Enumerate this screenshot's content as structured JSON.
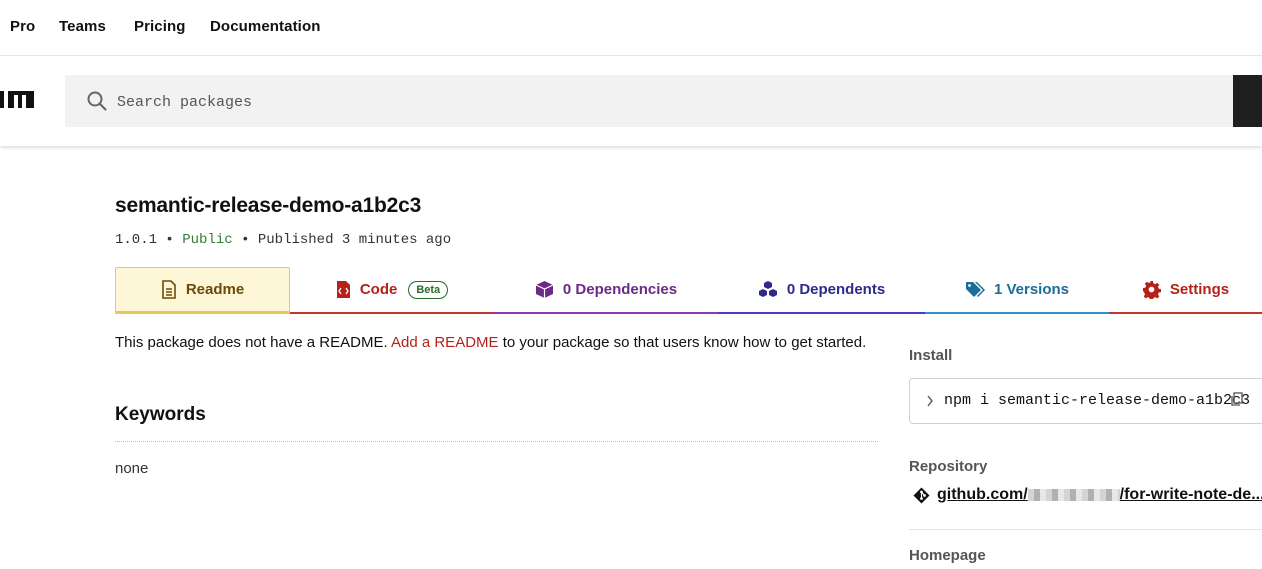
{
  "topnav": {
    "items": [
      "Pro",
      "Teams",
      "Pricing",
      "Documentation"
    ]
  },
  "search": {
    "placeholder": "Search packages"
  },
  "package": {
    "name": "semantic-release-demo-a1b2c3",
    "version": "1.0.1",
    "visibility": "Public",
    "separator": "•",
    "published": "Published 3 minutes ago"
  },
  "tabs": {
    "readme": "Readme",
    "code": "Code",
    "code_badge": "Beta",
    "dependencies": "0 Dependencies",
    "dependents": "0 Dependents",
    "versions": "1 Versions",
    "settings": "Settings"
  },
  "readme": {
    "text_before": "This package does not have a README. ",
    "link": "Add a README",
    "text_after": " to your package so that users know how to get started."
  },
  "keywords": {
    "heading": "Keywords",
    "value": "none"
  },
  "sidebar": {
    "install_label": "Install",
    "install_command": "npm i semantic-release-demo-a1b2c3",
    "repository_label": "Repository",
    "repository_prefix": "github.com/",
    "repository_suffix": "/for-write-note-de...",
    "homepage_label": "Homepage"
  },
  "colors": {
    "accent_red": "#b5221a",
    "readme_tab_bg": "#fdf7d7",
    "public_green": "#2f7d32"
  }
}
